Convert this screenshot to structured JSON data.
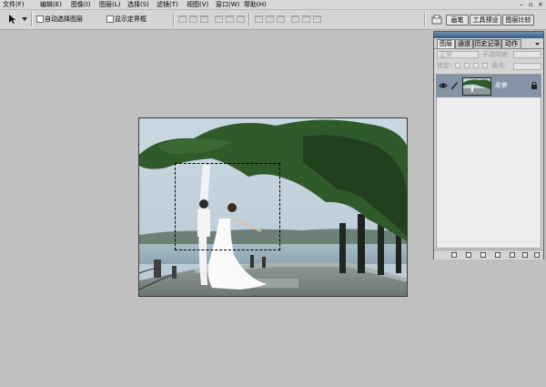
{
  "menubar": {
    "items": [
      {
        "label": "文件(F)"
      },
      {
        "label": "编辑(E)"
      },
      {
        "label": "图像(I)"
      },
      {
        "label": "图层(L)"
      },
      {
        "label": "选择(S)"
      },
      {
        "label": "滤镜(T)"
      },
      {
        "label": "视图(V)"
      },
      {
        "label": "窗口(W)"
      },
      {
        "label": "帮助(H)"
      }
    ],
    "window_controls": {
      "minimize": "–",
      "restore": "▫",
      "close": "×"
    }
  },
  "options_bar": {
    "tool_icon": "move-tool-icon",
    "auto_select_layer": "自动选择图层",
    "show_bounding_box": "显示定界框",
    "panel_well_tabs": [
      "画笔",
      "工具预设",
      "图层比较"
    ]
  },
  "layers_panel": {
    "tabs": [
      "图层",
      "通道",
      "历史记录",
      "动作"
    ],
    "blend_mode": "正常",
    "opacity_label": "不透明度:",
    "lock_label": "锁定:",
    "fill_label": "填充:",
    "layer": {
      "name": "背景"
    }
  },
  "colors": {
    "panel_title": "#3c5a82",
    "selected_layer": "#8494a6",
    "workspace": "#c0c0c0"
  }
}
